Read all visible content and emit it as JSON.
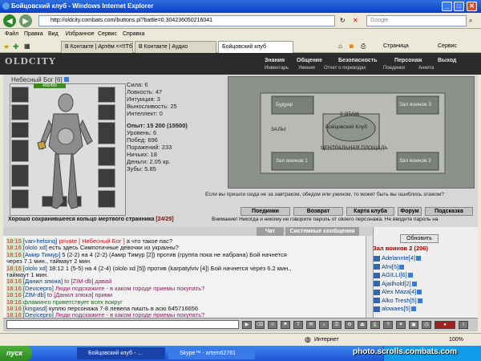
{
  "window": {
    "title": "Бойцовский клуб - Windows Internet Explorer",
    "url": "http://oldcity.combats.com/buttons.pl?battle=0.304236050216041",
    "search_placeholder": "Google"
  },
  "menu": [
    "Файл",
    "Правка",
    "Вид",
    "Избранное",
    "Сервис",
    "Справка"
  ],
  "tabs": [
    "В Контакте | Артём <<!!Тб...",
    "В Контакте | Аудио",
    "Бойцовский клуб"
  ],
  "toolbar": {
    "page": "Страница",
    "service": "Сервис"
  },
  "game": {
    "logo": "OLDCITY",
    "top_menu": [
      "Знания",
      "Общение",
      "Безопасность",
      "Персонаж",
      "Выход"
    ],
    "sub_menu": [
      "Инвентарь",
      "Умения",
      "Отчет о переводах",
      "Поединки",
      "Анкета"
    ],
    "character": {
      "name": "Небесный Бог",
      "level": "[6]",
      "hp": "400/400"
    },
    "stats": [
      "Сила: 6",
      "Ловкость: 47",
      "Интуиция: 3",
      "Выносливость: 25",
      "Интеллект: 0",
      "",
      "Опыт: 15 200 (15500)",
      "Уровень: 6",
      "Побед: 696",
      "Поражений: 233",
      "Ничьих: 18",
      "Деньги: 2.05 кр.",
      "Зубы: 5.85"
    ],
    "map": {
      "locations": [
        "Будуар",
        "Зал воинов 3",
        "2 ЭТАЖ",
        "Бойцовский Клуб",
        "ЗАЛЫ",
        "ЦЕНТРАЛЬНАЯ ПЛОЩАДЬ",
        "Зал воинов 1",
        "Зал воинов 2"
      ],
      "hint": "Если вы пришли сюда не за завтраком, обедом или ужином, то может быть вы ошиблись этажом?"
    },
    "buttons": [
      "Поединки",
      "Возврат",
      "Карта клуба",
      "Форум",
      "Подсказка"
    ],
    "ring_message": "Хорошо сохранившееся кольцо мертвого странника",
    "ring_count": "[24/25]",
    "warning": "Внимание! Никогда и никому не говорите пароль от своего персонажа. Не вводите пароль на"
  },
  "chat": {
    "tabs": [
      "Чат",
      "Системные сообщения"
    ],
    "lines": [
      {
        "time": "18:15",
        "parts": [
          {
            "c": "n",
            "t": "[van-helsinq]"
          },
          {
            "c": "p",
            "t": " private [ Небесный Бог ]"
          },
          {
            "c": "",
            "t": " а что такое пас?"
          }
        ]
      },
      {
        "time": "18:16",
        "parts": [
          {
            "c": "n",
            "t": "[ololo xd]"
          },
          {
            "c": "",
            "t": " есть здесь Симпотичные девочки из украины?"
          }
        ]
      },
      {
        "time": "18:16",
        "parts": [
          {
            "c": "n",
            "t": "[Амир Тимур]"
          },
          {
            "c": "",
            "t": " 5 (2-2) на 4 (2-2) (Амир Тимур [2]) против (группа пока не набрана) Бой начнется"
          }
        ]
      },
      {
        "time": "",
        "parts": [
          {
            "c": "",
            "t": "через 7.1 мин., таймаут 2 мин."
          }
        ]
      },
      {
        "time": "18:16",
        "parts": [
          {
            "c": "n",
            "t": "[ololo xd]"
          },
          {
            "c": "",
            "t": " 18:12 1 (5-5) на 4 (2-4) (ololo xd [5]) против (karpatylviv [4]) Бой начнется через 6.2 мин.,"
          }
        ]
      },
      {
        "time": "",
        "parts": [
          {
            "c": "",
            "t": "таймаут 1 мин."
          }
        ]
      },
      {
        "time": "18:16",
        "parts": [
          {
            "c": "n",
            "t": "[Данил злюка]"
          },
          {
            "c": "sys",
            "t": " to [ZIM-db] давай"
          }
        ]
      },
      {
        "time": "18:16",
        "parts": [
          {
            "c": "n",
            "t": "[Devicepro]"
          },
          {
            "c": "sys",
            "t": " Люди подскажите - в каком городе приемы покупать?"
          }
        ]
      },
      {
        "time": "18:16",
        "parts": [
          {
            "c": "n",
            "t": "[ZIM-db]"
          },
          {
            "c": "sys",
            "t": " to [Данил злюка] прими"
          }
        ]
      },
      {
        "time": "18:16",
        "parts": [
          {
            "c": "grn",
            "t": "фламинго приветствует всех вокруг"
          }
        ]
      },
      {
        "time": "18:16",
        "parts": [
          {
            "c": "n",
            "t": "[kingasd]"
          },
          {
            "c": "",
            "t": " куплю персонажа 7-8 левела пишть в асю 645716656"
          }
        ]
      },
      {
        "time": "18:16",
        "parts": [
          {
            "c": "n",
            "t": "[Devicepro]"
          },
          {
            "c": "sys",
            "t": " Люди подскажите - в каком городе приемы покупать?"
          }
        ]
      }
    ]
  },
  "room": {
    "refresh": "Обновить",
    "title": "Зал воинов 2 (206)",
    "players": [
      "Adelannte[4]",
      "Afni[5]",
      "AGILLI[6]",
      "Ajailhold[2]",
      "Alex Maza[4]",
      "Alko Tresh[5]",
      "alowaes[5]"
    ]
  },
  "statusbar": {
    "zone": "Интернет",
    "zoom": "100%"
  },
  "taskbar": {
    "start": "пуск",
    "tasks": [
      "Бойцовский клуб - ...",
      "Skype™ - artem62761"
    ]
  },
  "watermark": "photo.scrolls.combats.com"
}
